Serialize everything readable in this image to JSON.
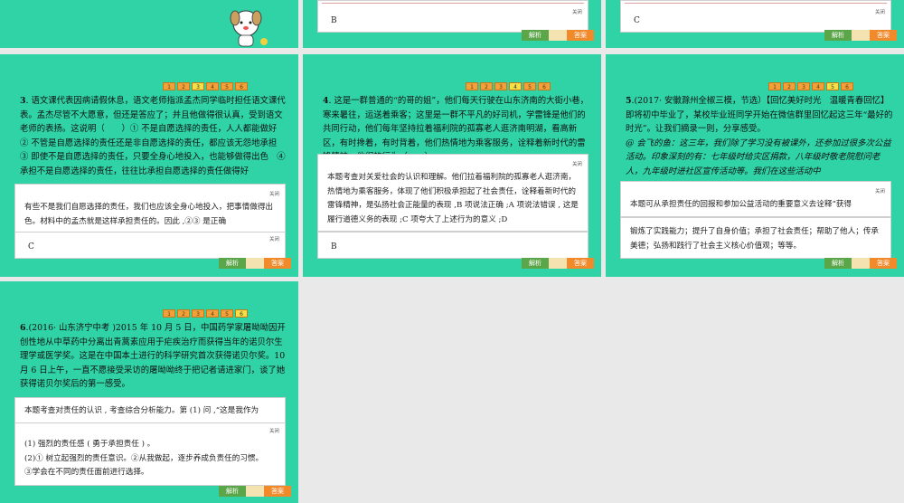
{
  "common": {
    "pages": [
      "1",
      "2",
      "3",
      "4",
      "5",
      "6"
    ],
    "close_label": "关闭",
    "analysis_label": "解析",
    "answer_label": "答案",
    "colors": {
      "slide_bg": "#2fd3a6",
      "page_btn": "#f2a13a",
      "page_active": "#f7e046",
      "analysis_btn": "#5ca64a",
      "answer_btn": "#f08a2b"
    }
  },
  "slide2": {
    "answer": "B"
  },
  "slide3": {
    "answer": "C"
  },
  "slide4": {
    "active_page": "3",
    "q_num": "3",
    "question": ". 语文课代表因病请假休息，语文老师指派孟杰同学临时担任语文课代表。孟杰尽管不大愿意，但还是答应了；并且他做得很认真，受到语文老师的表扬。这说明（　　）① 不是自愿选择的责任，人人都能做好　② 不管是自愿选择的责任还是非自愿选择的责任，都应该无怨地承担　③ 即使不是自愿选择的责任，只要全身心地投入，也能够做得出色　④ 承担不是自愿选择的责任，往往比承担自愿选择的责任做得好",
    "analysis": "有些不是我们自愿选择的责任，我们也应该全身心地投入，把事情做得出色。材料中的孟杰就是这样承担责任的。因此 ,②③ 是正确",
    "answer": "C"
  },
  "slide5": {
    "active_page": "4",
    "q_num": "4",
    "question": ". 这是一群普通的“的哥的姐”，他们每天行驶在山东济南的大街小巷，寒来暑往，运送着乘客；这里是一群不平凡的好司机，学雷锋是他们的共同行动，他们每年坚持拉着福利院的孤寡老人逛济南明湖，看高新区，有时搀着，有时背着，他们热情地为乘客服务，诠释着新时代的雷锋精神。他们的行为（　　）",
    "analysis": "本题考查对关爱社会的认识和理解。他们拉着福利院的孤寡老人逛济南，热情地为乘客服务，体现了他们积极承担起了社会责任，诠释着新时代的雷锋精神，是弘扬社会正能量的表现 ,B 项说法正确 ;A 项说法错误 , 这是履行道德义务的表现 ;C 项夸大了上述行为的意义 ;D",
    "answer": "B"
  },
  "slide6": {
    "active_page": "5",
    "q_num": "5",
    "question_head": ".(2017· 安徽滁州全椒三模，节选）【回忆美好时光　温暖青春回忆】",
    "question": "即将初中毕业了，某校毕业班同学开始在微信群里回忆起这三年“最好的时光”。让我们摘录一则，分享感受。",
    "quote": "@ 会飞的鱼：这三年，我们除了学习没有被课外，还参加过很多次公益活动。印象深刻的有：七年级时给灾区捐款，八年级时敬老院慰问老人，九年级时进社区宣传活动等。我们在这些活动中",
    "analysis": "本题可从承担责任的回报和参加公益活动的重要意义去诠释“获得",
    "answer": "锻炼了实践能力；提升了自身价值；承担了社会责任；帮助了他人；传承美德；弘扬和践行了社会主义核心价值观；等等。"
  },
  "slide7": {
    "active_page": "6",
    "q_num": "6",
    "question_head": ".(2016· 山东济宁中考 )2015 年 10 月 5 日，",
    "question": "中国药学家屠呦呦因开创性地从中草药中分离出青蒿素应用于疟疾治疗而获得当年的诺贝尔生理学或医学奖。这是在中国本土进行的科学研究首次获得诺贝尔奖。10 月 6 日上午，一直不愿接受采访的屠呦呦终于把记者请进家门，谈了她获得诺贝尔奖后的第一感受。",
    "analysis": "本题考查对责任的认识 , 考查综合分析能力。第 (1) 问 ,“这是我作为",
    "answer_lines": [
      "(1) 强烈的责任感 ( 勇于承担责任 ) 。",
      "(2)① 树立起强烈的责任意识。②从我做起，逐步养成负责任的习惯。",
      "③学会在不同的责任面前进行选择。"
    ]
  }
}
